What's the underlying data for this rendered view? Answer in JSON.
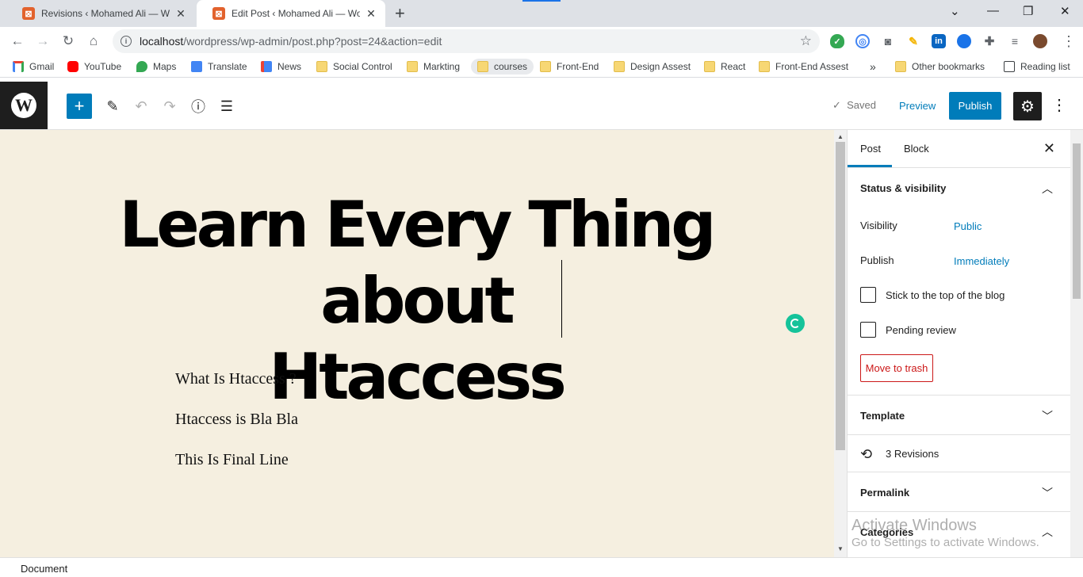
{
  "browser": {
    "tabs": [
      {
        "title": "Revisions ‹ Mohamed Ali — WordPress",
        "active": false
      },
      {
        "title": "Edit Post ‹ Mohamed Ali — WordPress",
        "active": true
      }
    ],
    "url_host": "localhost",
    "url_path": "/wordpress/wp-admin/post.php?post=24&action=edit"
  },
  "bookmarks": [
    {
      "label": "Gmail",
      "icon": "gmail-icon"
    },
    {
      "label": "YouTube",
      "icon": "youtube-icon"
    },
    {
      "label": "Maps",
      "icon": "maps-icon"
    },
    {
      "label": "Translate",
      "icon": "translate-icon"
    },
    {
      "label": "News",
      "icon": "news-icon"
    },
    {
      "label": "Social Control",
      "icon": "folder-icon"
    },
    {
      "label": "Markting",
      "icon": "folder-icon"
    },
    {
      "label": "courses",
      "icon": "folder-icon"
    },
    {
      "label": "Front-End",
      "icon": "folder-icon"
    },
    {
      "label": "Design Assest",
      "icon": "folder-icon"
    },
    {
      "label": "React",
      "icon": "folder-icon"
    },
    {
      "label": "Front-End Assest",
      "icon": "folder-icon"
    },
    {
      "label": "»",
      "icon": "chevron-icon"
    },
    {
      "label": "Other bookmarks",
      "icon": "folder-icon"
    },
    {
      "label": "Reading list",
      "icon": "reading-list-icon"
    }
  ],
  "editor": {
    "saved_label": "Saved",
    "preview_label": "Preview",
    "publish_label": "Publish",
    "title_line1": "Learn Every Thing about",
    "title_line2": "Htaccess",
    "paragraphs": [
      "What Is Htaccess ?",
      "Htaccess is Bla Bla",
      "This Is Final Line"
    ]
  },
  "sidebar": {
    "tab_post": "Post",
    "tab_block": "Block",
    "status_heading": "Status & visibility",
    "visibility_label": "Visibility",
    "visibility_value": "Public",
    "publish_label": "Publish",
    "publish_value": "Immediately",
    "stick_label": "Stick to the top of the blog",
    "pending_label": "Pending review",
    "trash_label": "Move to trash",
    "template_heading": "Template",
    "revisions_label": "3 Revisions",
    "permalink_heading": "Permalink",
    "categories_heading": "Categories"
  },
  "watermark": {
    "line1": "Activate Windows",
    "line2": "Go to Settings to activate Windows."
  },
  "footer": {
    "breadcrumb": "Document"
  },
  "colors": {
    "accent": "#007cba",
    "canvas": "#f5efe0",
    "danger": "#cc1818"
  }
}
